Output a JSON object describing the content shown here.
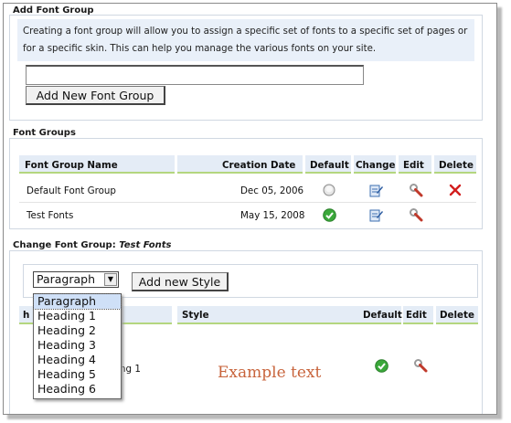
{
  "add_group": {
    "title": "Add Font Group",
    "info": "Creating a font group will allow you to assign a specific set of fonts to a specific set of pages or for a specific skin. This can help you manage the various fonts on your site.",
    "input_value": "",
    "add_button": "Add New Font Group"
  },
  "font_groups": {
    "title": "Font Groups",
    "headers": {
      "name": "Font Group Name",
      "date": "Creation Date",
      "default": "Default",
      "change": "Change",
      "edit": "Edit",
      "delete": "Delete"
    },
    "rows": [
      {
        "name": "Default Font Group",
        "date": "Dec 05, 2006",
        "is_default": false,
        "icons": {
          "default": "radio-off-icon",
          "change": "change-icon",
          "edit": "wrench-icon",
          "delete": "delete-x-icon"
        }
      },
      {
        "name": "Test Fonts",
        "date": "May 15, 2008",
        "is_default": true,
        "icons": {
          "default": "check-green-icon",
          "change": "change-icon",
          "edit": "wrench-icon",
          "delete": ""
        }
      }
    ]
  },
  "change_group": {
    "title_prefix": "Change Font Group:",
    "group_name": "Test Fonts",
    "select_value": "Paragraph",
    "add_style_button": "Add new Style",
    "dropdown_options": [
      "Paragraph",
      "Heading 1",
      "Heading 2",
      "Heading 3",
      "Heading 4",
      "Heading 5",
      "Heading 6"
    ],
    "headers": {
      "first": "h",
      "style": "Style",
      "default": "Default",
      "edit": "Edit",
      "delete": "Delete"
    },
    "row": {
      "partial_name": "ng 1",
      "example": "Example text"
    }
  },
  "colors": {
    "header_bg": "#e4ecf6",
    "header_underline": "#b4d67f",
    "info_bg": "#e9f0f9",
    "example_text": "#c8643c",
    "delete_red": "#d21e1e",
    "check_green": "#3aa83a"
  }
}
